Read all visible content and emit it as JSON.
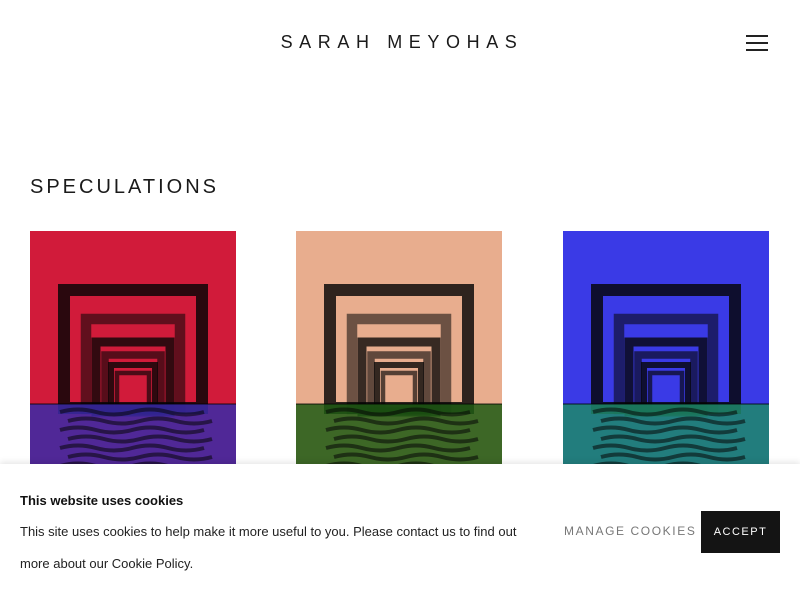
{
  "header": {
    "site_title": "SARAH MEYOHAS",
    "menu_icon": "hamburger-menu-icon"
  },
  "section": {
    "title": "SPECULATIONS"
  },
  "artworks": [
    {
      "kind": "portal-reflection-photo",
      "background": "#d11b3a",
      "water": "#3a2aa8"
    },
    {
      "kind": "portal-reflection-photo",
      "background": "#e8ad8e",
      "water": "#1f5a14"
    },
    {
      "kind": "portal-reflection-photo",
      "background": "#3a3ae6",
      "water": "#1f8a6a"
    }
  ],
  "cookie_banner": {
    "heading": "This website uses cookies",
    "text_before_link": "This site uses cookies to help make it more useful to you. Please contact us to find out more about our ",
    "link_text": "Cookie Policy",
    "text_after_link": ".",
    "manage_label": "MANAGE COOKIES",
    "accept_label": "ACCEPT"
  }
}
